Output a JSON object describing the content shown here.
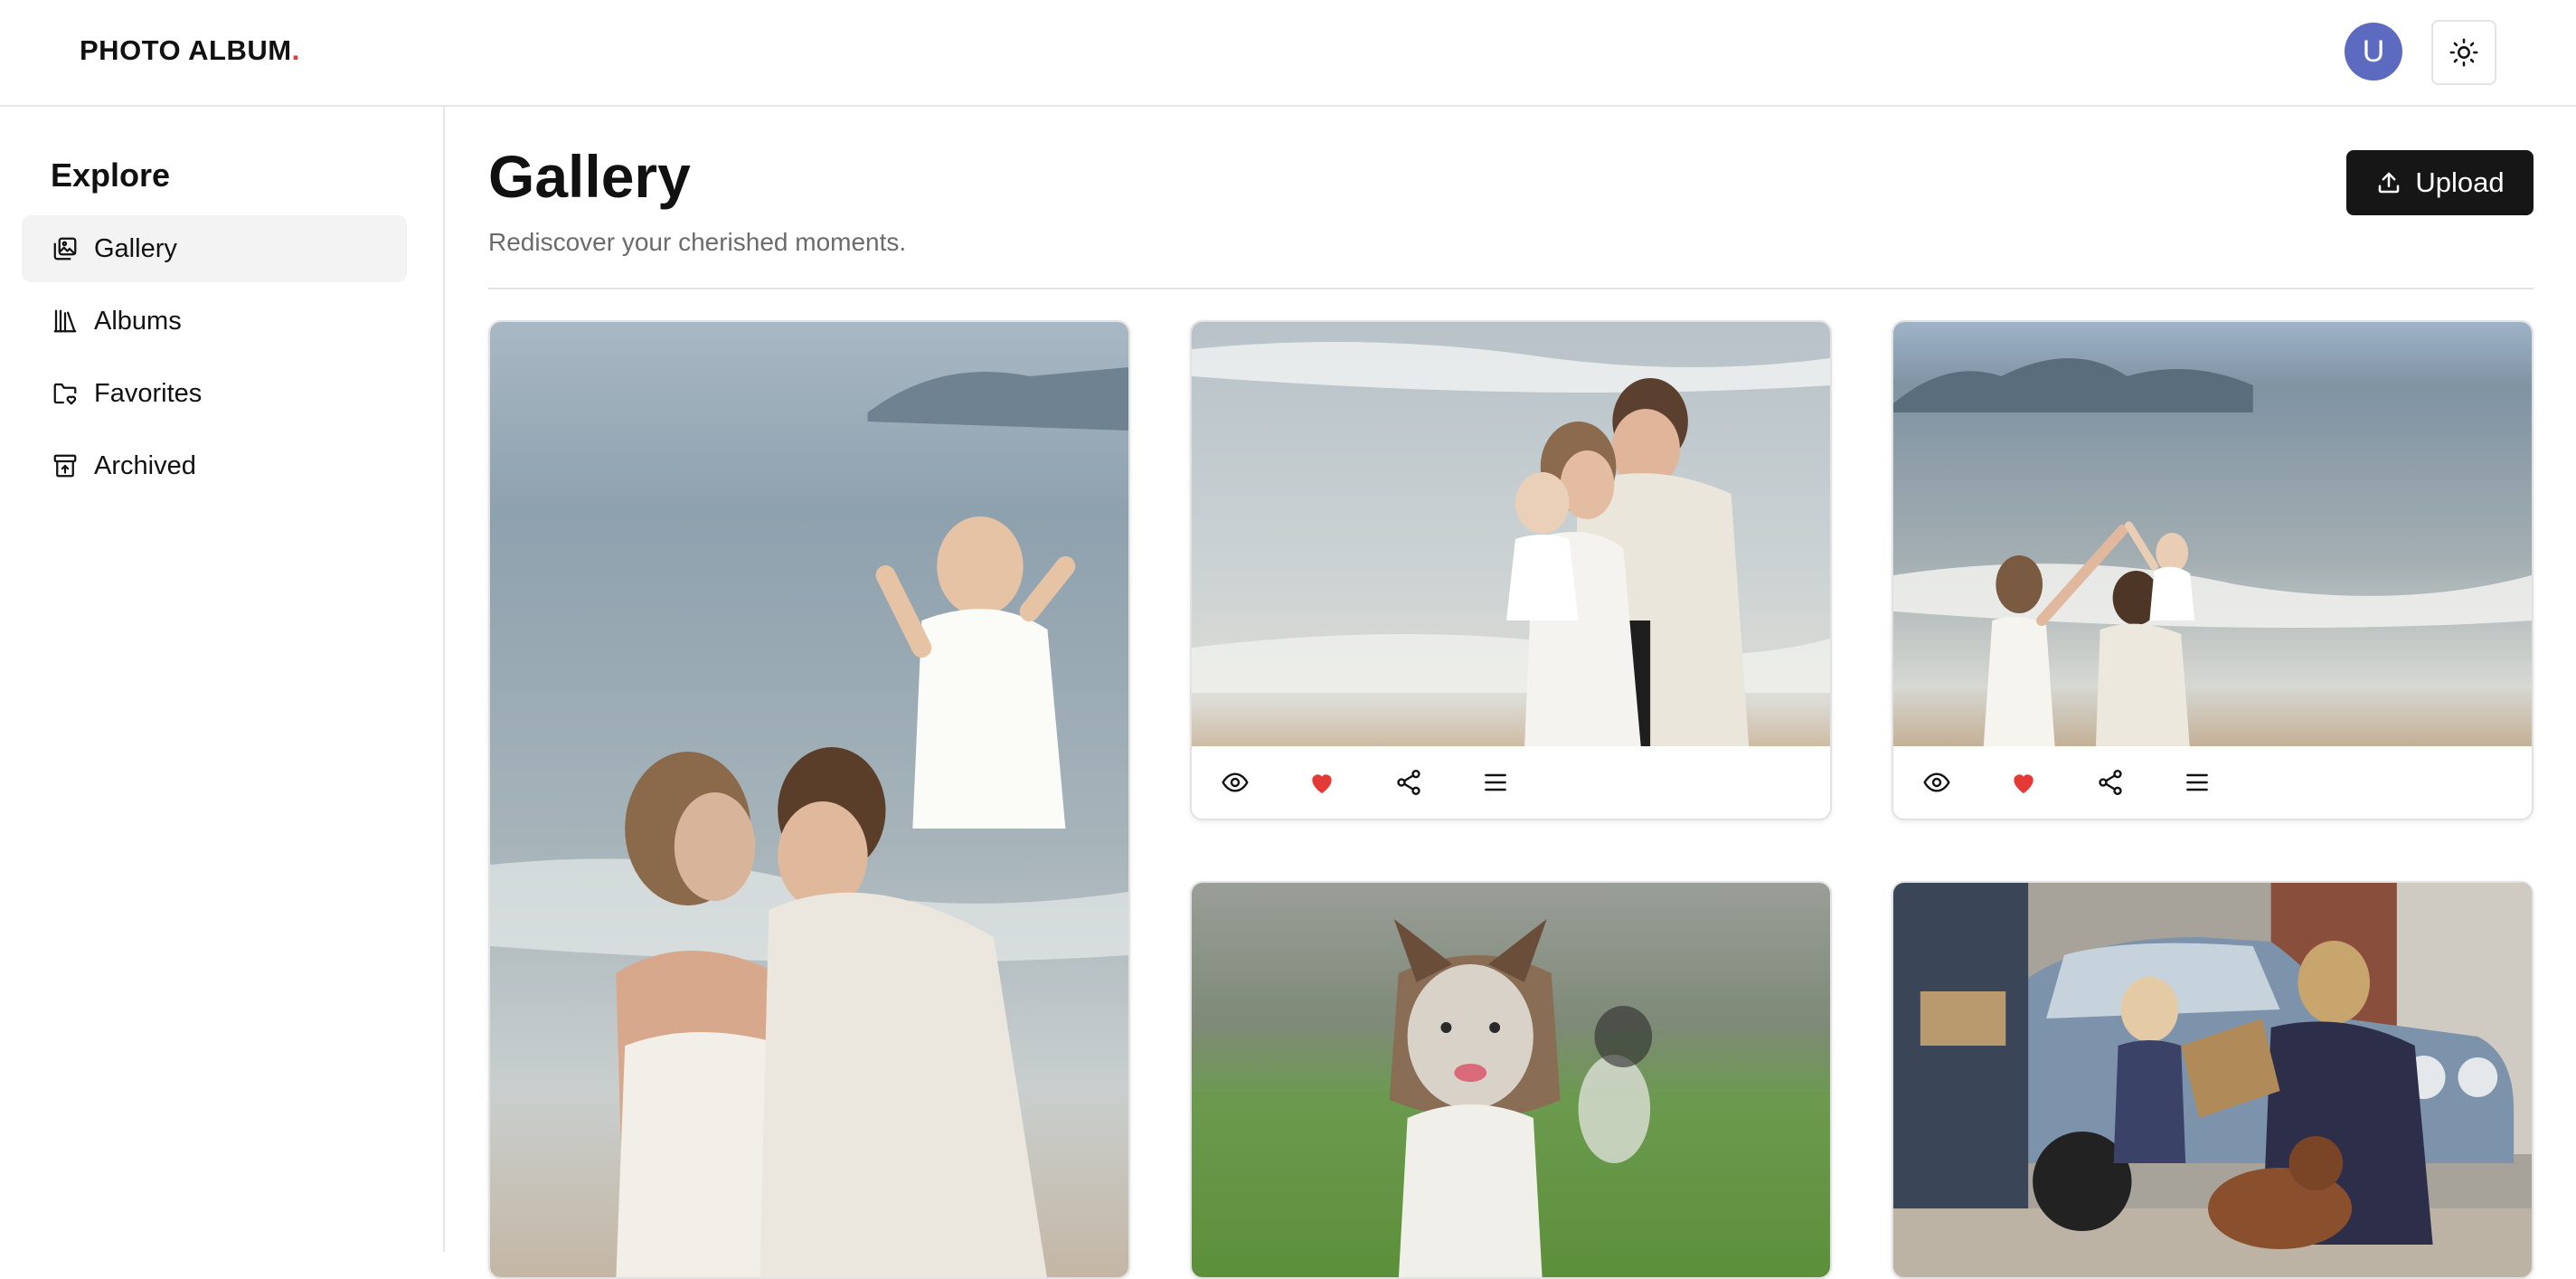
{
  "header": {
    "brand": "PHOTO ALBUM",
    "brand_dot": ".",
    "avatar_initial": "U",
    "theme_icon": "sun-icon"
  },
  "sidebar": {
    "title": "Explore",
    "items": [
      {
        "label": "Gallery",
        "icon": "gallery-icon",
        "active": true
      },
      {
        "label": "Albums",
        "icon": "library-icon",
        "active": false
      },
      {
        "label": "Favorites",
        "icon": "folder-heart-icon",
        "active": false
      },
      {
        "label": "Archived",
        "icon": "archive-icon",
        "active": false
      }
    ]
  },
  "main": {
    "title": "Gallery",
    "subtitle": "Rediscover your cherished moments.",
    "upload_label": "Upload",
    "accent_color": "#e53935"
  },
  "photos": [
    {
      "scene": "couple kissing on beach with child on shoulders"
    },
    {
      "scene": "bride and groom with baby walking on beach"
    },
    {
      "scene": "bride and groom high-fiving child on beach"
    },
    {
      "scene": "australian shepherd dog running on grass"
    },
    {
      "scene": "family exchanging gifts beside a vintage car"
    }
  ]
}
